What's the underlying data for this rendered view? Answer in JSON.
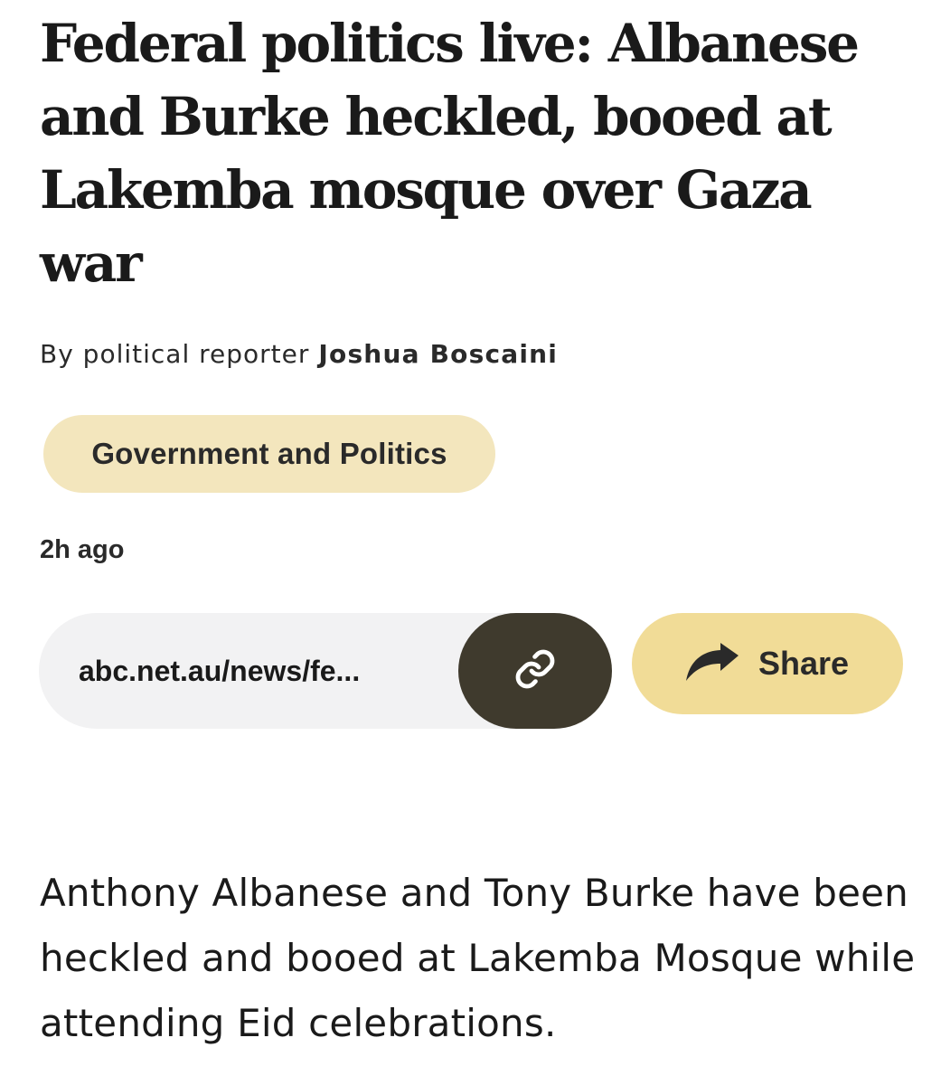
{
  "article": {
    "headline": "Federal politics live: Albanese and Burke heckled, booed at Lakemba mosque over Gaza war",
    "byline": {
      "prefix": "By political reporter",
      "author": "Joshua Boscaini"
    },
    "topic": "Government and Politics",
    "timestamp": "2h ago",
    "share_bar": {
      "url": "abc.net.au/news/fe...",
      "copy_icon": "link-icon",
      "share_icon": "share-arrow-icon",
      "share_label": "Share"
    },
    "lead": "Anthony Albanese and Tony Burke have been heckled and booed at Lakemba Mosque while attending Eid celebrations."
  },
  "colors": {
    "topic_tag_bg": "#f3e6bd",
    "share_button_bg": "#f1dc97",
    "copy_button_bg": "#3f3a2d",
    "url_box_bg": "#f2f2f3",
    "text": "#1a1a1a"
  }
}
